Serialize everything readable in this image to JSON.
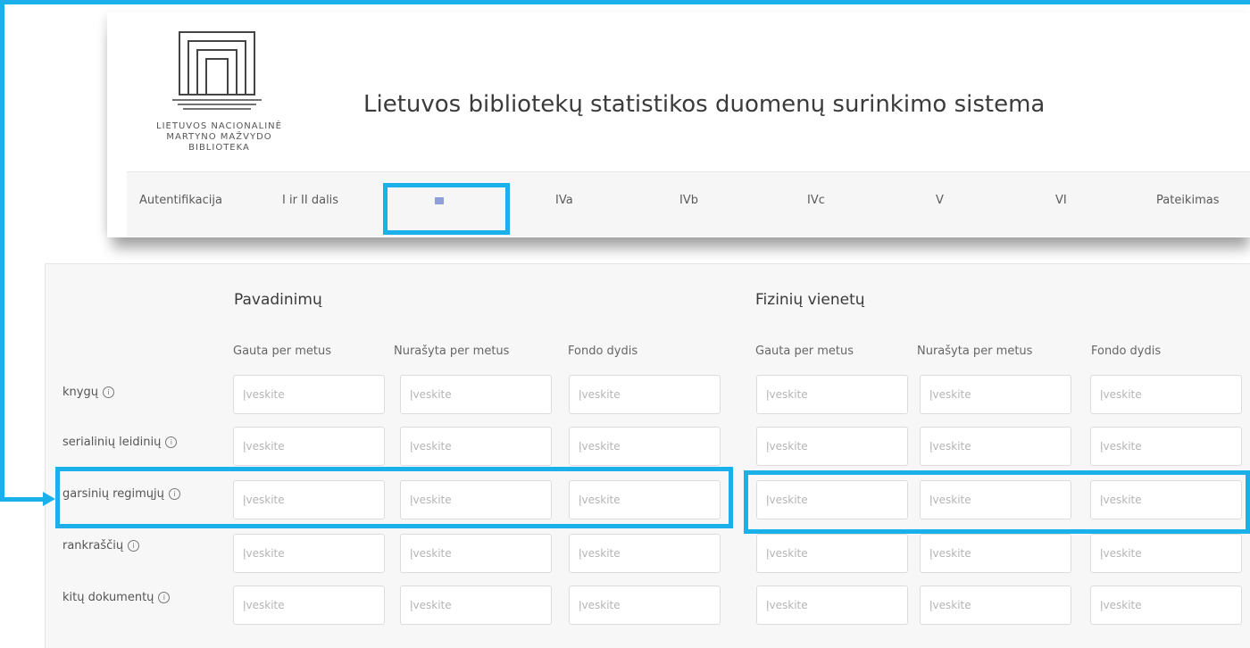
{
  "logo": {
    "line1": "LIETUVOS NACIONALINĖ",
    "line2": "MARTYNO MAŽVYDO",
    "line3": "BIBLIOTEKA"
  },
  "app_title": "Lietuvos bibliotekų statistikos duomenų surinkimo sistema",
  "nav": {
    "items": [
      {
        "label": "Autentifikacija"
      },
      {
        "label": "I ir II dalis"
      },
      {
        "label": ""
      },
      {
        "label": "IVa"
      },
      {
        "label": "IVb"
      },
      {
        "label": "IVc"
      },
      {
        "label": "V"
      },
      {
        "label": "VI"
      },
      {
        "label": "Pateikimas"
      }
    ]
  },
  "groups": {
    "left": "Pavadinimų",
    "right": "Fizinių vienetų"
  },
  "columns": [
    "Gauta per metus",
    "Nurašyta per metus",
    "Fondo dydis"
  ],
  "rows": [
    {
      "label": "knygų"
    },
    {
      "label": "serialinių leidinių"
    },
    {
      "label": "garsinių regimųjų"
    },
    {
      "label": "rankraščių"
    },
    {
      "label": "kitų dokumentų"
    }
  ],
  "field_placeholder": "Įveskite",
  "info_glyph": "i",
  "colors": {
    "highlight": "#1ab0ea",
    "active_tab_marker": "#8fa0d8"
  }
}
